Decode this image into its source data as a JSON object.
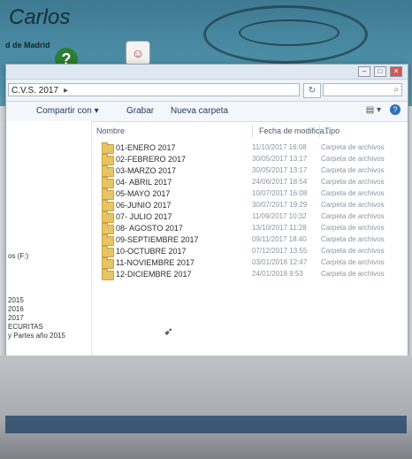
{
  "desktop": {
    "title": "Carlos",
    "subtitle": "d de Madrid"
  },
  "window": {
    "address": "C.V.S. 2017",
    "toolbar": {
      "share": "Compartir con ▾",
      "burn": "Grabar",
      "new_folder": "Nueva carpeta"
    },
    "columns": {
      "name": "Nombre",
      "date": "Fecha de modifica...",
      "type": "Tipo"
    },
    "nav_items": [
      "os (F:)",
      "2015",
      "2016",
      "2017",
      "ECURITAS",
      "y Partes año 2015"
    ],
    "files": [
      {
        "name": "01-ENERO 2017",
        "date": "11/10/2017 16:08",
        "type": "Carpeta de archivos"
      },
      {
        "name": "02-FEBRERO 2017",
        "date": "30/05/2017 13:17",
        "type": "Carpeta de archivos"
      },
      {
        "name": "03-MARZO 2017",
        "date": "30/05/2017 13:17",
        "type": "Carpeta de archivos"
      },
      {
        "name": "04- ABRIL 2017",
        "date": "24/06/2017 18:54",
        "type": "Carpeta de archivos"
      },
      {
        "name": "05-MAYO 2017",
        "date": "10/07/2017 16:08",
        "type": "Carpeta de archivos"
      },
      {
        "name": "06-JUNIO 2017",
        "date": "30/07/2017 19:29",
        "type": "Carpeta de archivos"
      },
      {
        "name": "07- JULIO 2017",
        "date": "11/09/2017 10:32",
        "type": "Carpeta de archivos"
      },
      {
        "name": "08- AGOSTO 2017",
        "date": "13/10/2017 11:28",
        "type": "Carpeta de archivos"
      },
      {
        "name": "09-SEPTIEMBRE 2017",
        "date": "09/11/2017 18:40",
        "type": "Carpeta de archivos"
      },
      {
        "name": "10-OCTUBRE 2017",
        "date": "07/12/2017 13:55",
        "type": "Carpeta de archivos"
      },
      {
        "name": "11-NOVIEMBRE 2017",
        "date": "03/01/2018 12:47",
        "type": "Carpeta de archivos"
      },
      {
        "name": "12-DICIEMBRE 2017",
        "date": "24/01/2018 9:53",
        "type": "Carpeta de archivos"
      }
    ]
  }
}
